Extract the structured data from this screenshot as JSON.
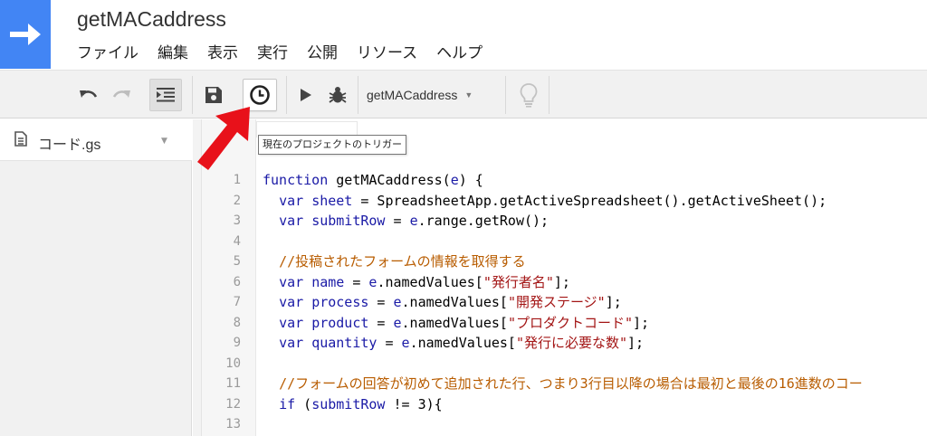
{
  "app": {
    "title": "getMACaddress",
    "brand_color": "#4285f4",
    "logo_icon": "arrow-right-icon"
  },
  "menu": {
    "items": [
      "ファイル",
      "編集",
      "表示",
      "実行",
      "公開",
      "リソース",
      "ヘルプ"
    ]
  },
  "toolbar": {
    "buttons": [
      "undo-icon",
      "redo-icon",
      "indent-icon",
      "save-icon",
      "clock-icon",
      "run-icon",
      "debug-icon",
      "lightbulb-icon"
    ],
    "function_select": "getMACaddress",
    "tooltip": "現在のプロジェクトのトリガー"
  },
  "sidebar": {
    "file": "コード.gs"
  },
  "annotation": {
    "arrow_color": "#e8111a"
  },
  "editor": {
    "line_numbers": [
      "1",
      "2",
      "3",
      "4",
      "5",
      "6",
      "7",
      "8",
      "9",
      "10",
      "11",
      "12",
      "13"
    ],
    "lines": [
      [
        [
          "kw",
          "function"
        ],
        [
          "t",
          " getMACaddress("
        ],
        [
          "vr",
          "e"
        ],
        [
          "t",
          ") {"
        ]
      ],
      [
        [
          "t",
          "  "
        ],
        [
          "kw",
          "var"
        ],
        [
          "t",
          " "
        ],
        [
          "vr",
          "sheet"
        ],
        [
          "t",
          " = SpreadsheetApp.getActiveSpreadsheet().getActiveSheet();"
        ]
      ],
      [
        [
          "t",
          "  "
        ],
        [
          "kw",
          "var"
        ],
        [
          "t",
          " "
        ],
        [
          "vr",
          "submitRow"
        ],
        [
          "t",
          " = "
        ],
        [
          "vr",
          "e"
        ],
        [
          "t",
          ".range.getRow();"
        ]
      ],
      [],
      [
        [
          "t",
          "  "
        ],
        [
          "cm",
          "//投稿されたフォームの情報を取得する"
        ]
      ],
      [
        [
          "t",
          "  "
        ],
        [
          "kw",
          "var"
        ],
        [
          "t",
          " "
        ],
        [
          "vr",
          "name"
        ],
        [
          "t",
          " = "
        ],
        [
          "vr",
          "e"
        ],
        [
          "t",
          ".namedValues["
        ],
        [
          "str",
          "\"発行者名\""
        ],
        [
          "t",
          "];"
        ]
      ],
      [
        [
          "t",
          "  "
        ],
        [
          "kw",
          "var"
        ],
        [
          "t",
          " "
        ],
        [
          "vr",
          "process"
        ],
        [
          "t",
          " = "
        ],
        [
          "vr",
          "e"
        ],
        [
          "t",
          ".namedValues["
        ],
        [
          "str",
          "\"開発ステージ\""
        ],
        [
          "t",
          "];"
        ]
      ],
      [
        [
          "t",
          "  "
        ],
        [
          "kw",
          "var"
        ],
        [
          "t",
          " "
        ],
        [
          "vr",
          "product"
        ],
        [
          "t",
          " = "
        ],
        [
          "vr",
          "e"
        ],
        [
          "t",
          ".namedValues["
        ],
        [
          "str",
          "\"プロダクトコード\""
        ],
        [
          "t",
          "];"
        ]
      ],
      [
        [
          "t",
          "  "
        ],
        [
          "kw",
          "var"
        ],
        [
          "t",
          " "
        ],
        [
          "vr",
          "quantity"
        ],
        [
          "t",
          " = "
        ],
        [
          "vr",
          "e"
        ],
        [
          "t",
          ".namedValues["
        ],
        [
          "str",
          "\"発行に必要な数\""
        ],
        [
          "t",
          "];"
        ]
      ],
      [],
      [
        [
          "t",
          "  "
        ],
        [
          "cm",
          "//フォームの回答が初めて追加された行、つまり3行目以降の場合は最初と最後の16進数のコー"
        ]
      ],
      [
        [
          "t",
          "  "
        ],
        [
          "kw",
          "if"
        ],
        [
          "t",
          " ("
        ],
        [
          "vr",
          "submitRow"
        ],
        [
          "t",
          " != 3){"
        ]
      ],
      []
    ]
  }
}
